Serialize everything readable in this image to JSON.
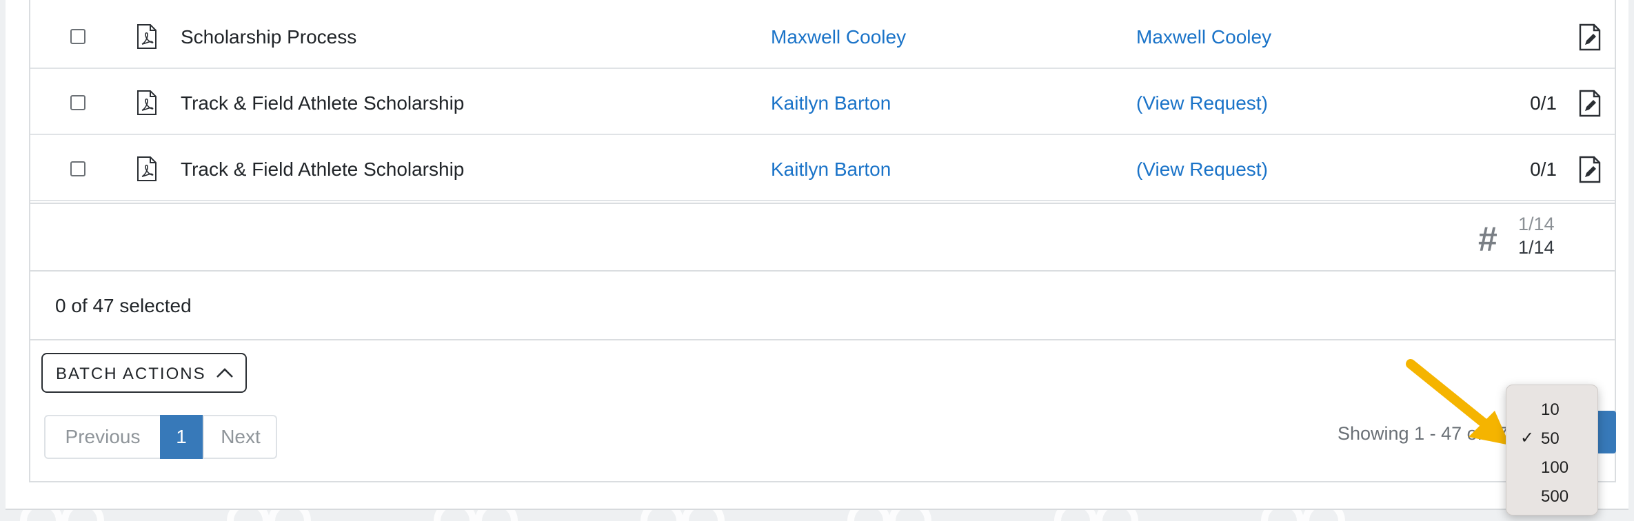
{
  "rows": [
    {
      "name": "Scholarship Process",
      "owner": "Maxwell Cooley",
      "request": "Maxwell Cooley",
      "count": ""
    },
    {
      "name": "Track & Field Athlete Scholarship",
      "owner": "Kaitlyn Barton",
      "request": "(View Request)",
      "count": "0/1"
    },
    {
      "name": "Track & Field Athlete Scholarship",
      "owner": "Kaitlyn Barton",
      "request": "(View Request)",
      "count": "0/1"
    }
  ],
  "summary": {
    "hash_icon": "hash-icon",
    "fraction_top": "1/14",
    "fraction_bottom": "1/14"
  },
  "selection": {
    "text": "0 of 47 selected"
  },
  "batch_actions": {
    "label": "BATCH ACTIONS",
    "icon": "chevron-up-icon"
  },
  "pagination": {
    "previous": "Previous",
    "current": "1",
    "next": "Next"
  },
  "showing_text": "Showing 1 - 47 of 47",
  "per_page_dropdown": {
    "options": [
      "10",
      "50",
      "100",
      "500"
    ],
    "selected": "50",
    "check_mark": "✓"
  },
  "colors": {
    "link": "#1a73c8",
    "primary": "#3779b9",
    "annotation_arrow": "#f5b400"
  }
}
